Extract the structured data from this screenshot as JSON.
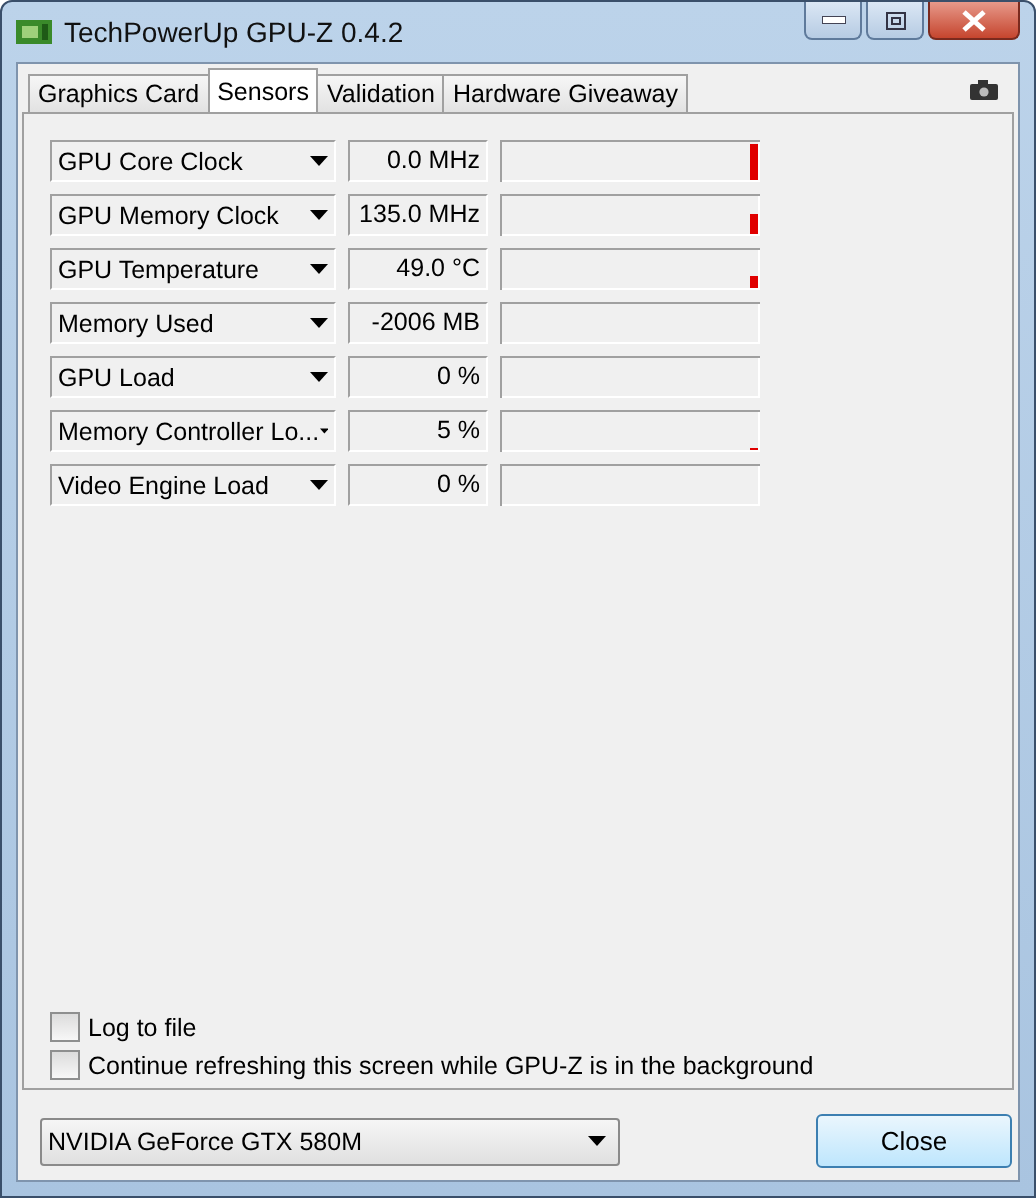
{
  "window": {
    "title": "TechPowerUp GPU-Z 0.4.2"
  },
  "tabs": [
    {
      "label": "Graphics Card",
      "selected": false
    },
    {
      "label": "Sensors",
      "selected": true
    },
    {
      "label": "Validation",
      "selected": false
    },
    {
      "label": "Hardware Giveaway",
      "selected": false
    }
  ],
  "sensors": [
    {
      "name": "GPU Core Clock",
      "reading": "0.0 MHz"
    },
    {
      "name": "GPU Memory Clock",
      "reading": "135.0 MHz"
    },
    {
      "name": "GPU Temperature",
      "reading": "49.0 °C"
    },
    {
      "name": "Memory Used",
      "reading": "-2006 MB"
    },
    {
      "name": "GPU Load",
      "reading": "0 %"
    },
    {
      "name": "Memory Controller Lo...",
      "reading": "5 %"
    },
    {
      "name": "Video Engine Load",
      "reading": "0 %"
    }
  ],
  "options": [
    {
      "label": "Log to file",
      "checked": false
    },
    {
      "label": "Continue refreshing this screen while GPU-Z is in the background",
      "checked": false
    }
  ],
  "gpu_select": {
    "value": "NVIDIA GeForce GTX 580M"
  },
  "buttons": [
    "Close"
  ]
}
